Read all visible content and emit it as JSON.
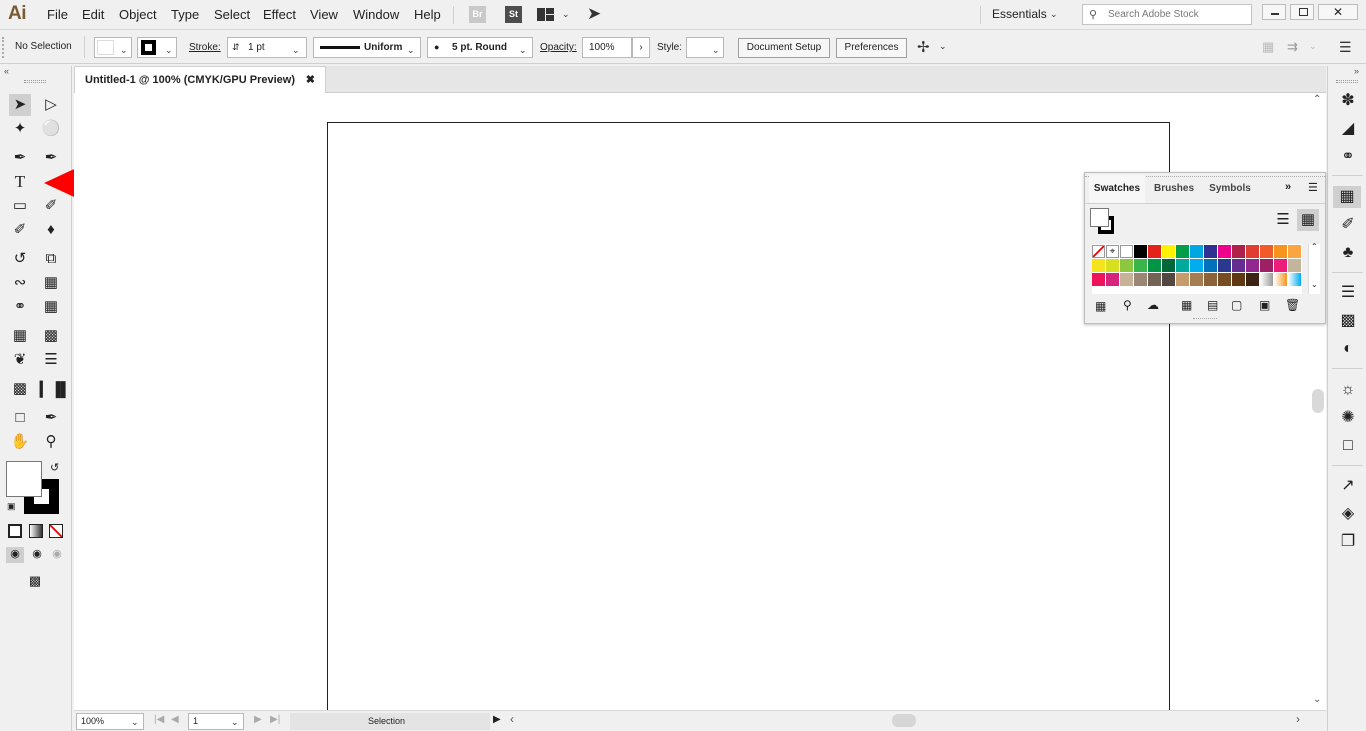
{
  "app": {
    "logo": "Ai"
  },
  "menu": [
    "File",
    "Edit",
    "Object",
    "Type",
    "Select",
    "Effect",
    "View",
    "Window",
    "Help"
  ],
  "menubar_icons": {
    "bridge": "Br",
    "stock": "St"
  },
  "workspace": {
    "label": "Essentials"
  },
  "search": {
    "placeholder": "Search Adobe Stock"
  },
  "control": {
    "selection": "No Selection",
    "stroke_label": "Stroke:",
    "stroke_weight": "1 pt",
    "profile": "Uniform",
    "brush": "5 pt. Round",
    "opacity_label": "Opacity:",
    "opacity": "100%",
    "style_label": "Style:",
    "document_setup": "Document Setup",
    "preferences": "Preferences"
  },
  "document": {
    "tab_title": "Untitled-1 @ 100% (CMYK/GPU Preview)"
  },
  "status": {
    "zoom": "100%",
    "page": "1",
    "tool": "Selection"
  },
  "swatches_panel": {
    "tabs": [
      "Swatches",
      "Brushes",
      "Symbols"
    ],
    "active_tab": "Swatches",
    "rows": [
      [
        "none",
        "#ffffff-reg",
        "#ffffff",
        "#000000",
        "#e3221c",
        "#fff200",
        "#009e49",
        "#00a8e1",
        "#2e3192",
        "#ec008c",
        "#b1204a",
        "#e03c31",
        "#f15a29",
        "#f7941d",
        "#f9a541"
      ],
      [
        "#f5e31d",
        "#d8df21",
        "#8dc63f",
        "#39b54a",
        "#009444",
        "#006838",
        "#00a99d",
        "#00aeef",
        "#0072bc",
        "#2b388f",
        "#662d91",
        "#92278f",
        "#9e1f63",
        "#ed1e79",
        "#c2b59b"
      ],
      [
        "#ed145b",
        "#d6237b",
        "#c7b299",
        "#998675",
        "#736357",
        "#534741",
        "#c69c6d",
        "#a67c52",
        "#8c6239",
        "#754c24",
        "#603913",
        "#3c2415",
        "#9a9a9a-grad",
        "#f7941d-grad",
        "#00aeef-grad"
      ]
    ]
  },
  "annotation": {
    "arrow_color": "#ff0000"
  }
}
